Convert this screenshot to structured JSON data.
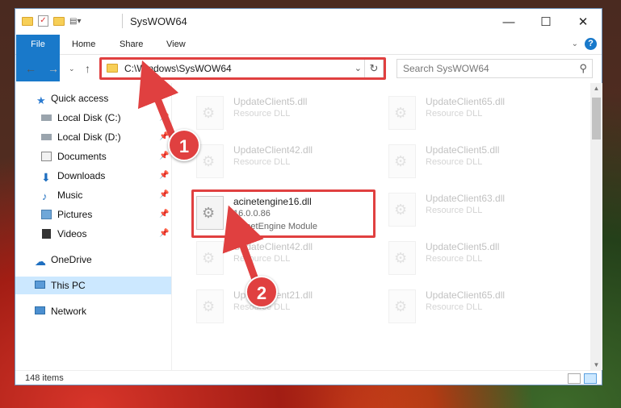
{
  "window": {
    "title": "SysWOW64",
    "controls": {
      "minimize": "—",
      "maximize": "☐",
      "close": "✕"
    }
  },
  "ribbon": {
    "tabs": [
      "File",
      "Home",
      "Share",
      "View"
    ],
    "help": "?"
  },
  "address": {
    "path": "C:\\Windows\\SysWOW64",
    "search_placeholder": "Search SysWOW64"
  },
  "sidebar": {
    "items": [
      {
        "label": "Quick access",
        "icon": "star-icon",
        "pinned": false
      },
      {
        "label": "Local Disk (C:)",
        "icon": "drive-icon",
        "pinned": true
      },
      {
        "label": "Local Disk (D:)",
        "icon": "drive-icon",
        "pinned": true
      },
      {
        "label": "Documents",
        "icon": "documents-icon",
        "pinned": true
      },
      {
        "label": "Downloads",
        "icon": "downloads-icon",
        "pinned": true
      },
      {
        "label": "Music",
        "icon": "music-icon",
        "pinned": true
      },
      {
        "label": "Pictures",
        "icon": "pictures-icon",
        "pinned": true
      },
      {
        "label": "Videos",
        "icon": "videos-icon",
        "pinned": true
      },
      {
        "label": "OneDrive",
        "icon": "cloud-icon",
        "pinned": false
      },
      {
        "label": "This PC",
        "icon": "computer-icon",
        "pinned": false,
        "selected": true
      },
      {
        "label": "Network",
        "icon": "network-icon",
        "pinned": false
      }
    ]
  },
  "files": [
    {
      "name": "UpdateClient5.dll",
      "sub": "Resource DLL",
      "sub2": ""
    },
    {
      "name": "UpdateClient65.dll",
      "sub": "Resource DLL",
      "sub2": ""
    },
    {
      "name": "UpdateClient42.dll",
      "sub": "Resource DLL",
      "sub2": ""
    },
    {
      "name": "UpdateClient5.dll",
      "sub": "Resource DLL",
      "sub2": ""
    },
    {
      "name": "acinetengine16.dll",
      "sub": "16.0.0.86",
      "sub2": "AclnetEngine Module",
      "highlighted": true
    },
    {
      "name": "UpdateClient63.dll",
      "sub": "Resource DLL",
      "sub2": ""
    },
    {
      "name": "UpdateClient42.dll",
      "sub": "Resource DLL",
      "sub2": ""
    },
    {
      "name": "UpdateClient5.dll",
      "sub": "Resource DLL",
      "sub2": ""
    },
    {
      "name": "UpdateClient21.dll",
      "sub": "Resource DLL",
      "sub2": ""
    },
    {
      "name": "UpdateClient65.dll",
      "sub": "Resource DLL",
      "sub2": ""
    }
  ],
  "status": {
    "count": "148 items"
  },
  "annotations": {
    "step1": "1",
    "step2": "2",
    "color": "#e04040"
  }
}
